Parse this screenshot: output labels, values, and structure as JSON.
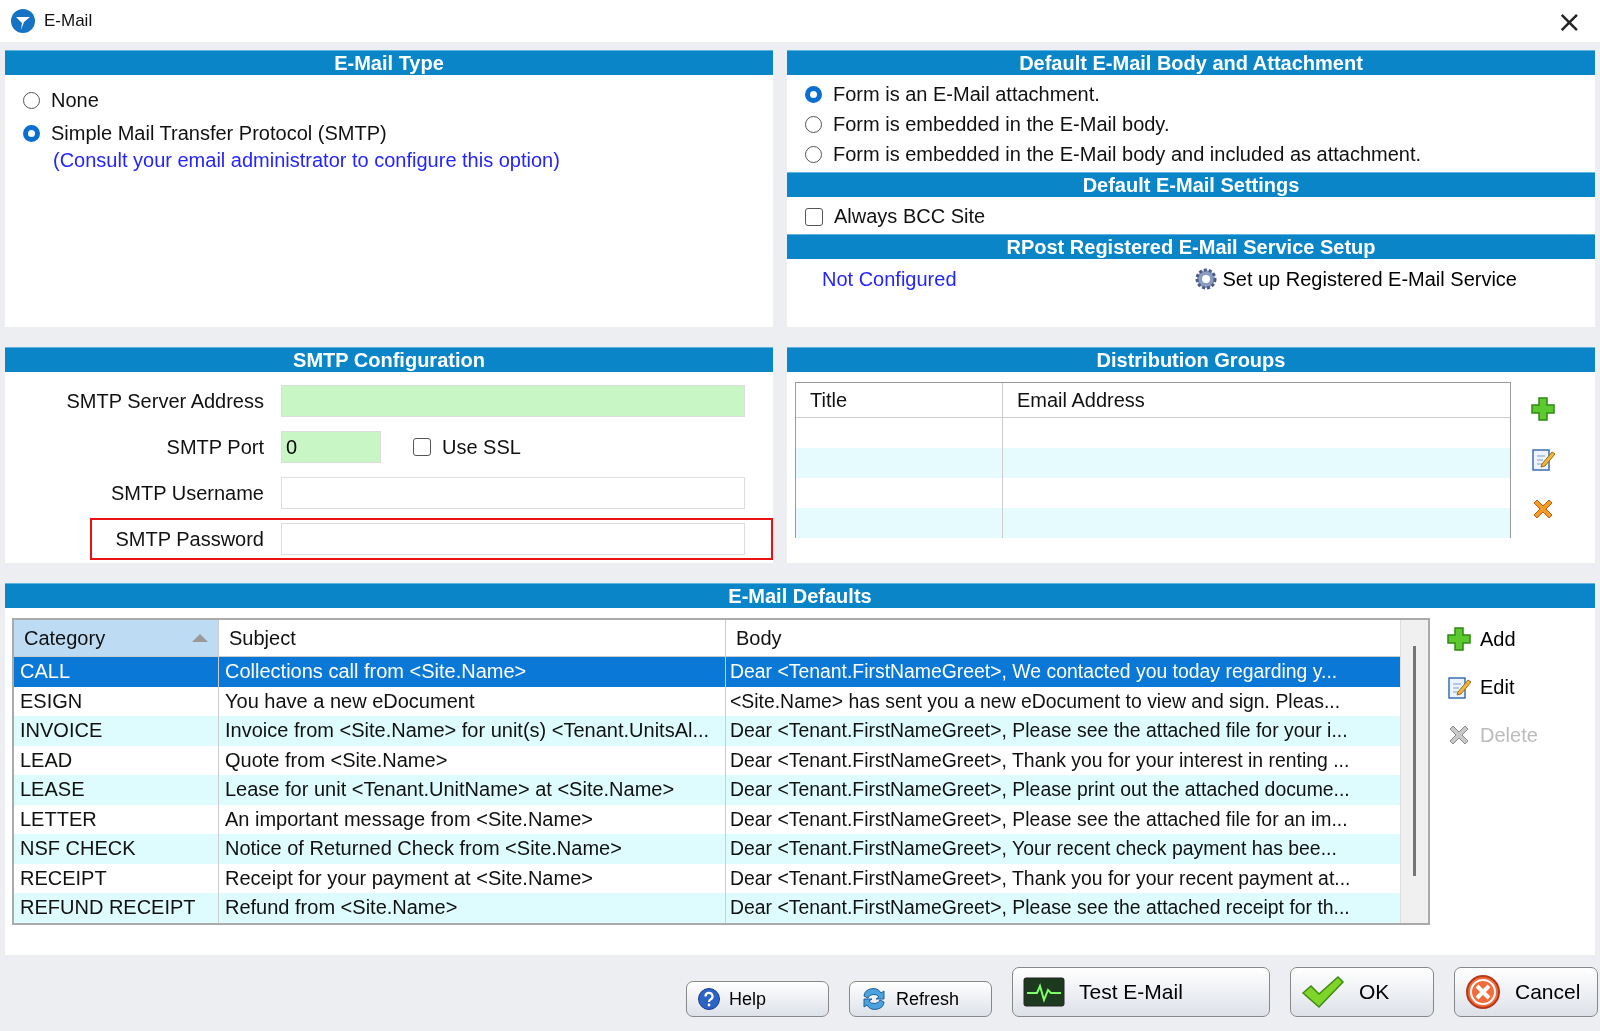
{
  "window": {
    "title": "E-Mail",
    "close": "×"
  },
  "email_type": {
    "title": "E-Mail Type",
    "options": [
      {
        "label": "None",
        "selected": false
      },
      {
        "label": "Simple Mail Transfer Protocol (SMTP)",
        "selected": true
      }
    ],
    "note": "(Consult your email administrator to configure this option)"
  },
  "body_attachment": {
    "title": "Default E-Mail Body and Attachment",
    "options": [
      {
        "label": "Form is an E-Mail attachment.",
        "selected": true
      },
      {
        "label": "Form is embedded in the E-Mail body.",
        "selected": false
      },
      {
        "label": "Form is embedded in the E-Mail body and included as attachment.",
        "selected": false
      }
    ]
  },
  "email_settings": {
    "title": "Default E-Mail Settings",
    "checkboxes": [
      {
        "label": "Always BCC Site",
        "checked": false
      }
    ]
  },
  "rpost": {
    "title": "RPost Registered E-Mail Service Setup",
    "status": "Not Configured",
    "setup": "Set up Registered E-Mail Service"
  },
  "smtp": {
    "title": "SMTP Configuration",
    "fields": [
      {
        "label": "SMTP Server Address",
        "color": "#c8f7c5",
        "highlighted": false
      },
      {
        "label": "SMTP Port",
        "value": "0",
        "color": "#c8f7c5",
        "highlighted": false,
        "kind": "port"
      },
      {
        "label": "SMTP Username",
        "color": "#ffffff",
        "highlighted": false
      },
      {
        "label": "SMTP Password",
        "color": "#ffffff",
        "highlighted": true
      }
    ],
    "use_ssl": {
      "label": "Use SSL",
      "checked": false
    }
  },
  "distribution": {
    "title": "Distribution Groups",
    "columns": [
      "Title",
      "Email Address"
    ]
  },
  "defaults": {
    "title": "E-Mail Defaults",
    "columns": [
      {
        "label": "Category",
        "sorted": true
      },
      {
        "label": "Subject",
        "sorted": false
      },
      {
        "label": "Body",
        "sorted": false
      }
    ],
    "rows": [
      {
        "category": "CALL",
        "subject": "Collections call from <Site.Name>",
        "body": "Dear <Tenant.FirstNameGreet>, We contacted you today regarding y...",
        "selected": true
      },
      {
        "category": "ESIGN",
        "subject": "You have a new eDocument",
        "body": "<Site.Name> has sent you a new eDocument to view and sign.  Pleas...",
        "selected": false
      },
      {
        "category": "INVOICE",
        "subject": "Invoice from <Site.Name> for unit(s) <Tenant.UnitsAl...",
        "body": "Dear <Tenant.FirstNameGreet>, Please see the attached file for your i...",
        "selected": false
      },
      {
        "category": "LEAD",
        "subject": "Quote from <Site.Name>",
        "body": "Dear <Tenant.FirstNameGreet>, Thank you for your interest in renting ...",
        "selected": false
      },
      {
        "category": "LEASE",
        "subject": "Lease for unit <Tenant.UnitName> at <Site.Name>",
        "body": "Dear <Tenant.FirstNameGreet>, Please print out the attached docume...",
        "selected": false
      },
      {
        "category": "LETTER",
        "subject": "An important message from <Site.Name>",
        "body": "Dear <Tenant.FirstNameGreet>, Please see the attached file for an im...",
        "selected": false
      },
      {
        "category": "NSF CHECK",
        "subject": "Notice of Returned Check from <Site.Name>",
        "body": "Dear <Tenant.FirstNameGreet>, Your recent check payment has bee...",
        "selected": false
      },
      {
        "category": "RECEIPT",
        "subject": "Receipt for your payment at <Site.Name>",
        "body": "Dear <Tenant.FirstNameGreet>, Thank you for your recent payment at...",
        "selected": false
      },
      {
        "category": "REFUND RECEIPT",
        "subject": "Refund from <Site.Name>",
        "body": "Dear <Tenant.FirstNameGreet>, Please see the attached receipt for th...",
        "selected": false
      }
    ],
    "actions": [
      {
        "label": "Add",
        "kind": "add",
        "disabled": false
      },
      {
        "label": "Edit",
        "kind": "edit",
        "disabled": false
      },
      {
        "label": "Delete",
        "kind": "delete",
        "disabled": true
      }
    ]
  },
  "buttons": [
    {
      "label": "Help",
      "kind": "help"
    },
    {
      "label": "Refresh",
      "kind": "refresh"
    },
    {
      "label": "Test E-Mail",
      "kind": "test"
    },
    {
      "label": "OK",
      "kind": "ok"
    },
    {
      "label": "Cancel",
      "kind": "cancel"
    }
  ]
}
